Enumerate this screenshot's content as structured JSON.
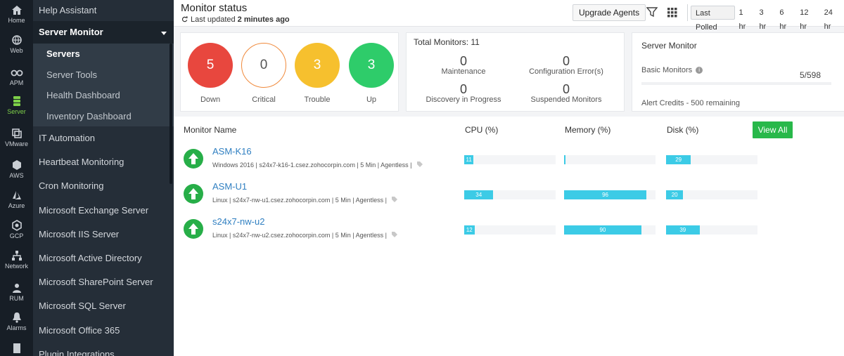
{
  "rail": [
    {
      "label": "Home",
      "icon": "home-icon"
    },
    {
      "label": "Web",
      "icon": "globe-icon"
    },
    {
      "label": "APM",
      "icon": "binoculars-icon"
    },
    {
      "label": "Server",
      "icon": "server-icon"
    },
    {
      "label": "VMware",
      "icon": "vmware-icon"
    },
    {
      "label": "AWS",
      "icon": "aws-icon"
    },
    {
      "label": "Azure",
      "icon": "azure-icon"
    },
    {
      "label": "GCP",
      "icon": "gcp-icon"
    },
    {
      "label": "Network",
      "icon": "network-icon"
    },
    {
      "label": "RUM",
      "icon": "rum-icon"
    },
    {
      "label": "Alarms",
      "icon": "bell-icon"
    }
  ],
  "sidebar": {
    "help": "Help Assistant",
    "section": "Server Monitor",
    "subitems": [
      "Servers",
      "Server Tools",
      "Health Dashboard",
      "Inventory Dashboard"
    ],
    "items": [
      "IT Automation",
      "Heartbeat Monitoring",
      "Cron Monitoring",
      "Microsoft Exchange Server",
      "Microsoft IIS Server",
      "Microsoft Active Directory",
      "Microsoft SharePoint Server",
      "Microsoft SQL Server",
      "Microsoft Office 365",
      "Plugin Integrations"
    ]
  },
  "header": {
    "title": "Monitor status",
    "updated_prefix": "Last updated ",
    "updated_value": "2 minutes ago",
    "upgrade_label": "Upgrade Agents",
    "periods": [
      "Last Polled",
      "1 hr",
      "3 hr",
      "6 hr",
      "12 hr",
      "24 hr"
    ]
  },
  "status": [
    {
      "count": "5",
      "label": "Down",
      "color": "#e8473e"
    },
    {
      "count": "0",
      "label": "Critical",
      "color": "#f08a3c"
    },
    {
      "count": "3",
      "label": "Trouble",
      "color": "#f6c02e"
    },
    {
      "count": "3",
      "label": "Up",
      "color": "#2ecc6a"
    }
  ],
  "totals": {
    "title": "Total Monitors: 11",
    "cells": [
      {
        "n": "0",
        "label": "Maintenance"
      },
      {
        "n": "0",
        "label": "Configuration Error(s)"
      },
      {
        "n": "0",
        "label": "Discovery in Progress"
      },
      {
        "n": "0",
        "label": "Suspended Monitors"
      }
    ]
  },
  "server_monitor": {
    "title": "Server Monitor",
    "basic_label": "Basic Monitors",
    "basic_count": "5/598",
    "credits": "Alert Credits - 500 remaining"
  },
  "table": {
    "columns": {
      "name": "Monitor Name",
      "cpu": "CPU (%)",
      "memory": "Memory (%)",
      "disk": "Disk (%)"
    },
    "view_all": "View All",
    "rows": [
      {
        "name": "ASM-K16",
        "meta": "Windows 2016 | s24x7-k16-1.csez.zohocorpin.com | 5 Min | Agentless |",
        "cpu": 11,
        "memory": 1,
        "disk": 29
      },
      {
        "name": "ASM-U1",
        "meta": "Linux | s24x7-nw-u1.csez.zohocorpin.com | 5 Min | Agentless |",
        "cpu": 34,
        "memory": 96,
        "disk": 20
      },
      {
        "name": "s24x7-nw-u2",
        "meta": "Linux | s24x7-nw-u2.csez.zohocorpin.com | 5 Min | Agentless |",
        "cpu": 12,
        "memory": 90,
        "disk": 39
      }
    ]
  },
  "colors": {
    "accent": "#2f7fc1",
    "bar": "#3ccbe6",
    "up": "#27ae48",
    "view_all": "#28b84a",
    "server_active": "#7fd24a"
  }
}
